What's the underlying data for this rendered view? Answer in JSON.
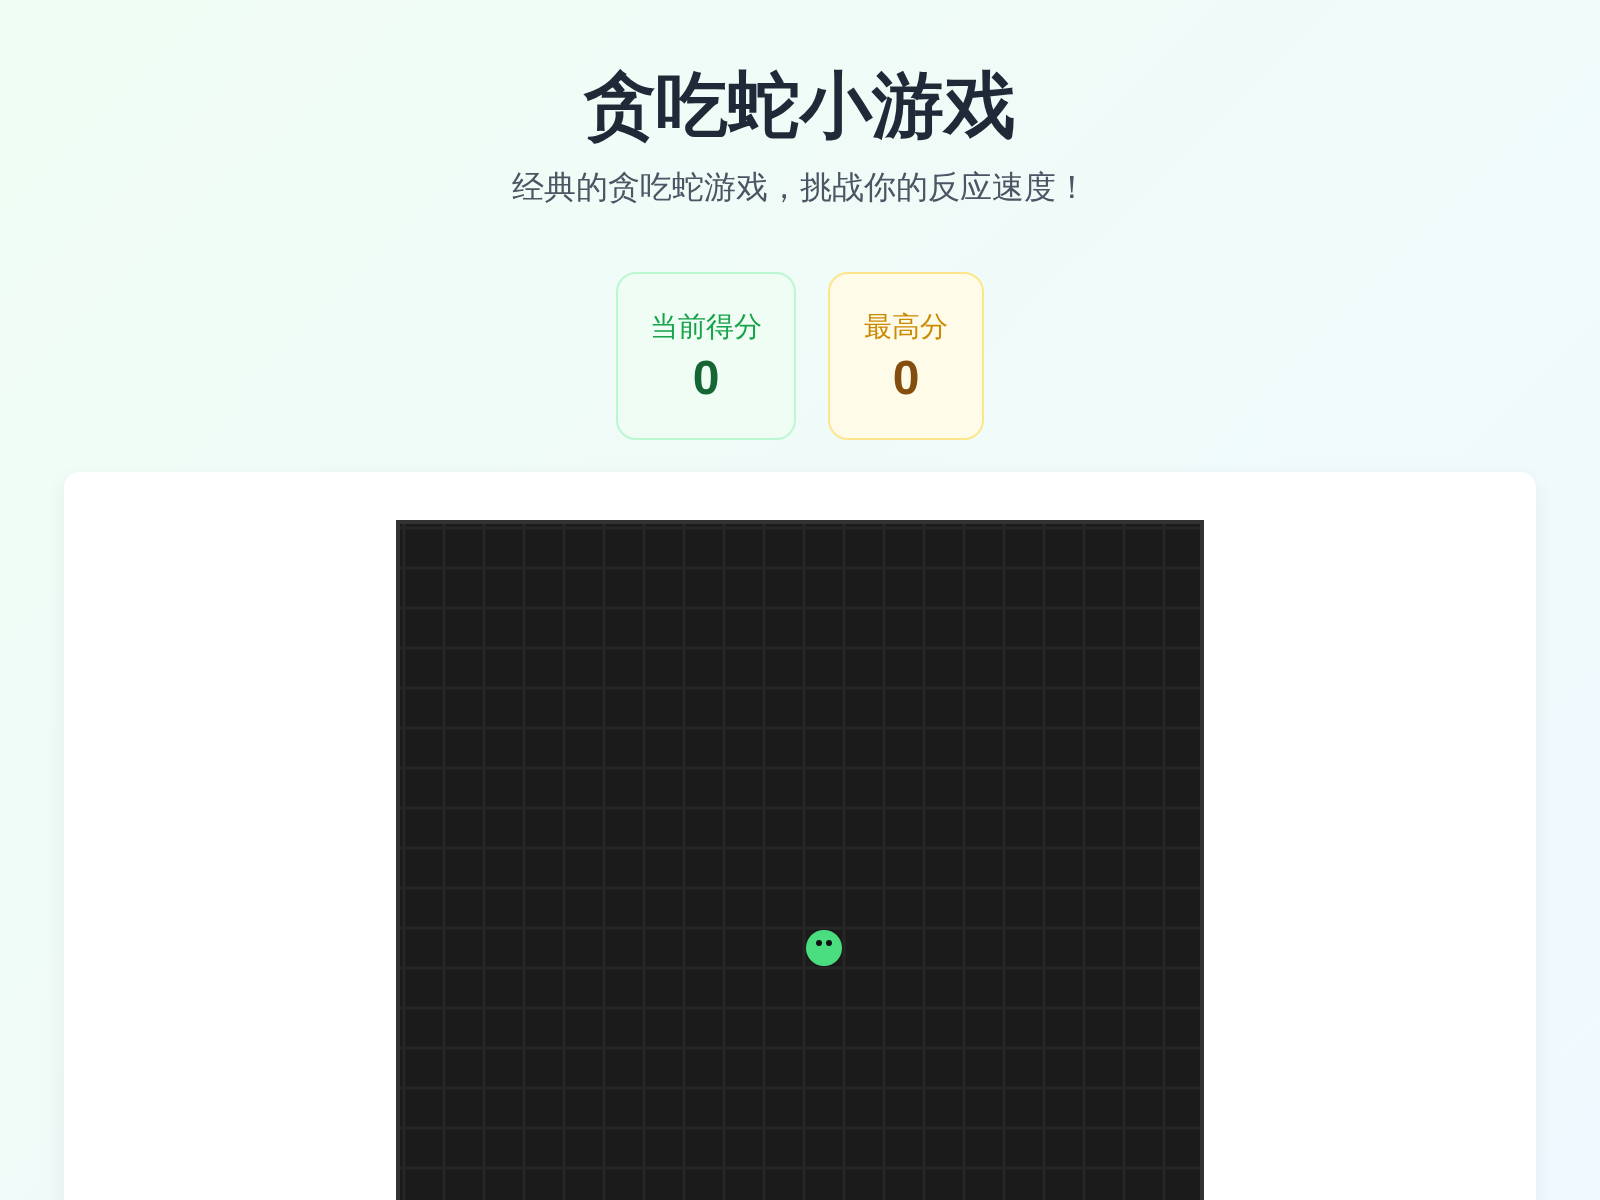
{
  "header": {
    "title": "贪吃蛇小游戏",
    "subtitle": "经典的贪吃蛇游戏，挑战你的反应速度！"
  },
  "scores": [
    {
      "kind": "current",
      "label": "当前得分",
      "value": "0"
    },
    {
      "kind": "best",
      "label": "最高分",
      "value": "0"
    }
  ]
}
